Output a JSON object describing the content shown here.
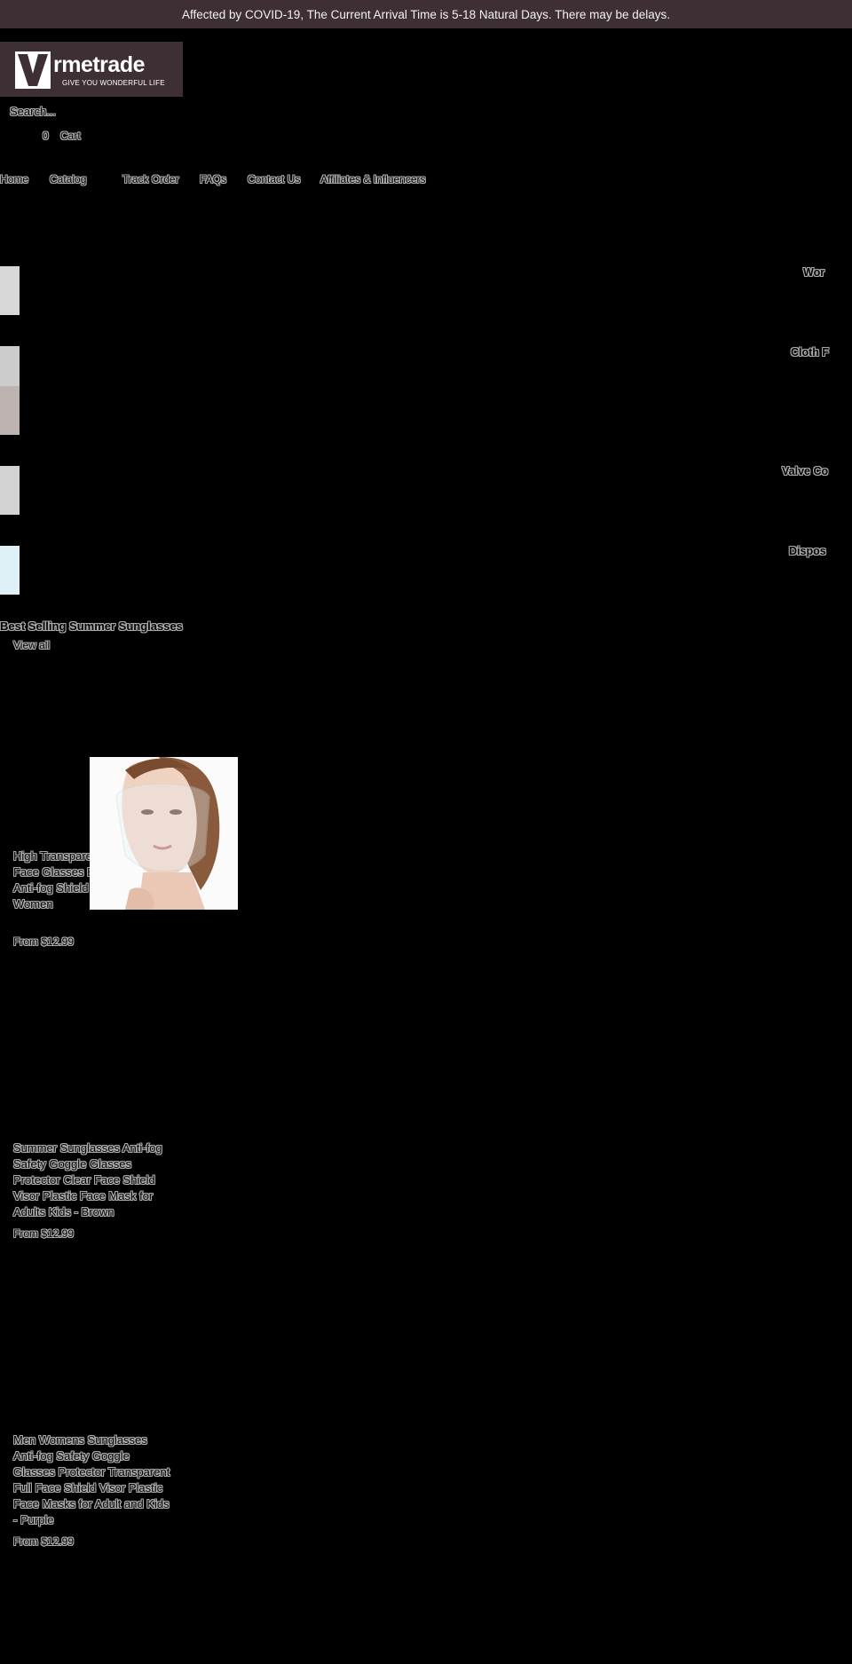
{
  "announcement": "Affected by COVID-19, The Current Arrival Time is 5-18 Natural Days. There may be delays.",
  "logo": {
    "wordmark": "rmetrade",
    "tagline": "GIVE YOU WONDERFUL LIFE"
  },
  "search": {
    "placeholder": "Search..."
  },
  "cart": {
    "count": "0",
    "label": "Cart"
  },
  "nav": [
    "Home",
    "Catalog",
    "Track Order",
    "FAQs",
    "Contact Us",
    "Affiliates & Influencers"
  ],
  "categories": [
    {
      "title": "Wor",
      "thumb_color": "#d7d7d7"
    },
    {
      "title": "Cloth F",
      "thumb_color": "#cccccc"
    },
    {
      "title": "Valve Co",
      "thumb_color": "#d3d3d3"
    },
    {
      "title": "Dispos",
      "thumb_color": "#dff0f7"
    }
  ],
  "section": {
    "title": "Best Selling Summer Sunglasses",
    "view_all": "View all"
  },
  "products": [
    {
      "title": "High Transparent Transparent Face Glasses Eyewear Clear Anti-fog Shield for Men and Women",
      "price": "From $12.99"
    },
    {
      "title": "Summer Sunglasses Anti-fog Safety Goggle Glasses Protector Clear Face Shield Visor Plastic Face Mask for Adults Kids - Brown",
      "price": "From $12.99"
    },
    {
      "title": "Men Womens Sunglasses Anti-fog Safety Goggle Glasses Protector Transparent Full Face Shield Visor Plastic Face Masks for Adult and Kids - Purple",
      "price": "From $12.99"
    }
  ]
}
